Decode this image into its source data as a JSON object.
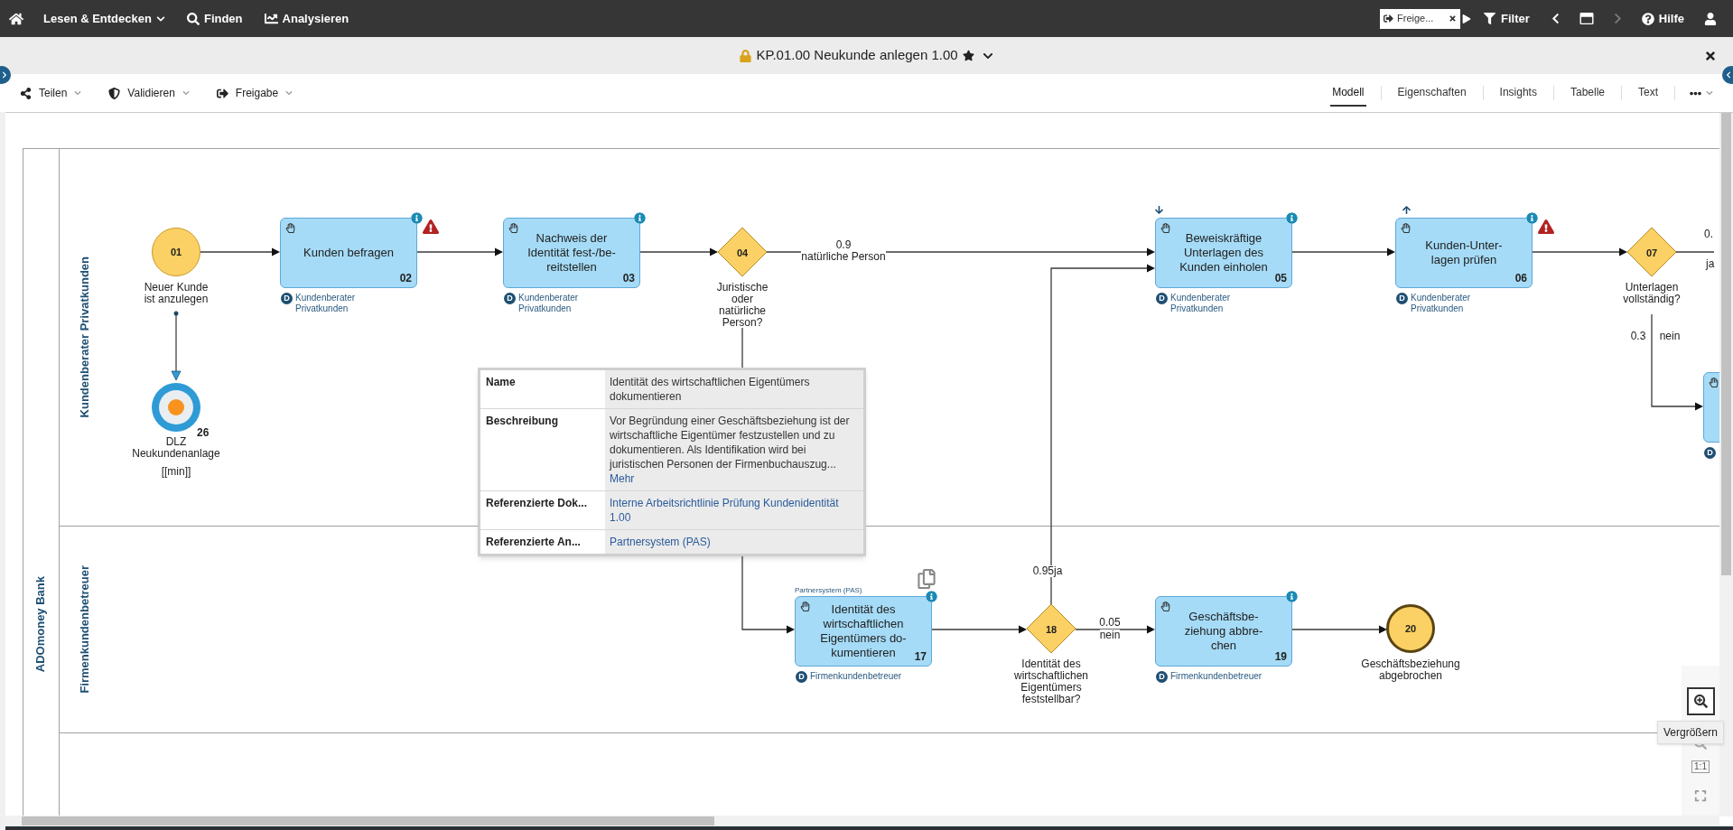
{
  "topbar": {
    "menu": [
      {
        "label": "Lesen & Entdecken",
        "kind": "dropdown"
      },
      {
        "label": "Finden",
        "kind": "search"
      },
      {
        "label": "Analysieren",
        "kind": "analyze"
      }
    ],
    "chip": "Freige...",
    "filter": "Filter",
    "forward_disabled": true,
    "help": "Hilfe"
  },
  "document": {
    "title": "KP.01.00 Neukunde anlegen 1.00",
    "favorite": true
  },
  "actions": [
    {
      "label": "Teilen",
      "kind": "share"
    },
    {
      "label": "Validieren",
      "kind": "validate"
    },
    {
      "label": "Freigabe",
      "kind": "release"
    }
  ],
  "tabs": [
    {
      "label": "Modell",
      "selected": true
    },
    {
      "label": "Eigenschaften",
      "selected": false
    },
    {
      "label": "Insights",
      "selected": false
    },
    {
      "label": "Tabelle",
      "selected": false
    },
    {
      "label": "Text",
      "selected": false
    }
  ],
  "diagram": {
    "pool": "ADOmoney Bank",
    "lanes": [
      "Kundenberater Privatkunden",
      "Firmenkundenbetreuer"
    ],
    "nodes": [
      {
        "kind": "start",
        "number": "01",
        "label": "Neuer Kunde\nist anzulegen"
      },
      {
        "kind": "kpi",
        "number": "26",
        "label": "DLZ\nNeukundenanlage",
        "unit": "[[min]]"
      },
      {
        "kind": "task",
        "number": "02",
        "label": "Kunden befragen",
        "role_badge": "D",
        "role": "Kundenberater\nPrivatkunden",
        "info": true,
        "warning": true
      },
      {
        "kind": "task",
        "number": "03",
        "label": "Nachweis der\nIdentität fest-/be-\nreitstellen",
        "role_badge": "D",
        "role": "Kundenberater\nPrivatkunden",
        "info": true,
        "warning": false
      },
      {
        "kind": "gateway",
        "number": "04",
        "label": "Juristische\noder\nnatürliche\nPerson?"
      },
      {
        "kind": "task",
        "number": "05",
        "label": "Beweiskräftige\nUnterlagen des\nKunden einholen",
        "role_badge": "D",
        "role": "Kundenberater\nPrivatkunden",
        "info": true,
        "warning": false,
        "arrow_down": true
      },
      {
        "kind": "task",
        "number": "06",
        "label": "Kunden-Unter-\nlagen prüfen",
        "role_badge": "D",
        "role": "Kundenberater\nPrivatkunden",
        "info": true,
        "warning": true,
        "arrow_up": true
      },
      {
        "kind": "gateway",
        "number": "07",
        "label": "Unterlagen\nvollständig?"
      },
      {
        "kind": "task",
        "role_badge": "D"
      },
      {
        "kind": "task",
        "number": "17",
        "label": "Identität des\nwirtschaftlichen\nEigentümers do-\nkumentieren",
        "role_badge": "D",
        "role": "Firmenkundenbetreuer",
        "info": true,
        "warning": false,
        "system": "Partnersystem (PAS)",
        "document": true
      },
      {
        "kind": "gateway",
        "number": "18",
        "label": "Identität des\nwirtschaftlichen\nEigentümers\nfeststellbar?"
      },
      {
        "kind": "task",
        "number": "19",
        "label": "Geschäftsbe-\nziehung abbre-\nchen",
        "role_badge": "D",
        "role": "Firmenkundenbetreuer",
        "info": true,
        "warning": false
      },
      {
        "kind": "end",
        "number": "20",
        "label": "Geschäftsbeziehung\nabgebrochen"
      }
    ],
    "edge_labels": [
      "0.9",
      "natürliche Person",
      "0.3",
      "nein",
      "0.",
      "ja",
      "0.95",
      "ja",
      "0.05",
      "nein"
    ]
  },
  "tooltip": {
    "rows": [
      {
        "label": "Name",
        "value": "Identität des wirtschaftlichen Eigentümers dokumentieren",
        "kind": "text"
      },
      {
        "label": "Beschreibung",
        "value": "Vor Begründung einer Geschäftsbeziehung ist der wirtschaftliche Eigentümer festzustellen und zu dokumentieren. Als Identifikation wird bei juristischen Personen der Firmenbuchauszug...",
        "more": "Mehr",
        "kind": "text"
      },
      {
        "label": "Referenzierte Dok...",
        "value": "Interne Arbeitsrichtlinie Prüfung Kundenidentität 1.00",
        "kind": "link"
      },
      {
        "label": "Referenzierte An...",
        "value": "Partnersystem (PAS)",
        "kind": "link"
      }
    ]
  },
  "zoom_controls": {
    "tooltip": "Vergrößern",
    "actual_size": "1:1"
  }
}
